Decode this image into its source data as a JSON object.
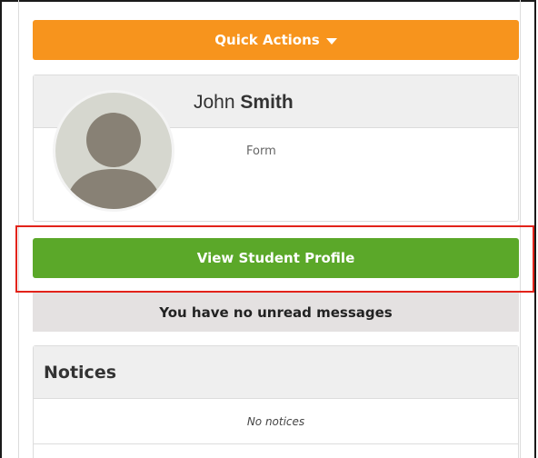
{
  "quick_actions": {
    "label": "Quick Actions"
  },
  "student": {
    "first_name": "John",
    "last_name": "Smith",
    "form_label": "Form"
  },
  "view_profile": {
    "label": "View Student Profile"
  },
  "messages": {
    "text": "You have no unread messages"
  },
  "notices": {
    "title": "Notices",
    "empty_text": "No notices"
  },
  "colors": {
    "quick_actions_bg": "#f7941d",
    "view_profile_bg": "#5ba829",
    "highlight_border": "#e2231a",
    "messages_bg": "#e4e1e1",
    "panel_header_bg": "#efefef"
  },
  "icons": {
    "dropdown": "caret-down-icon",
    "avatar": "person-silhouette-icon"
  }
}
